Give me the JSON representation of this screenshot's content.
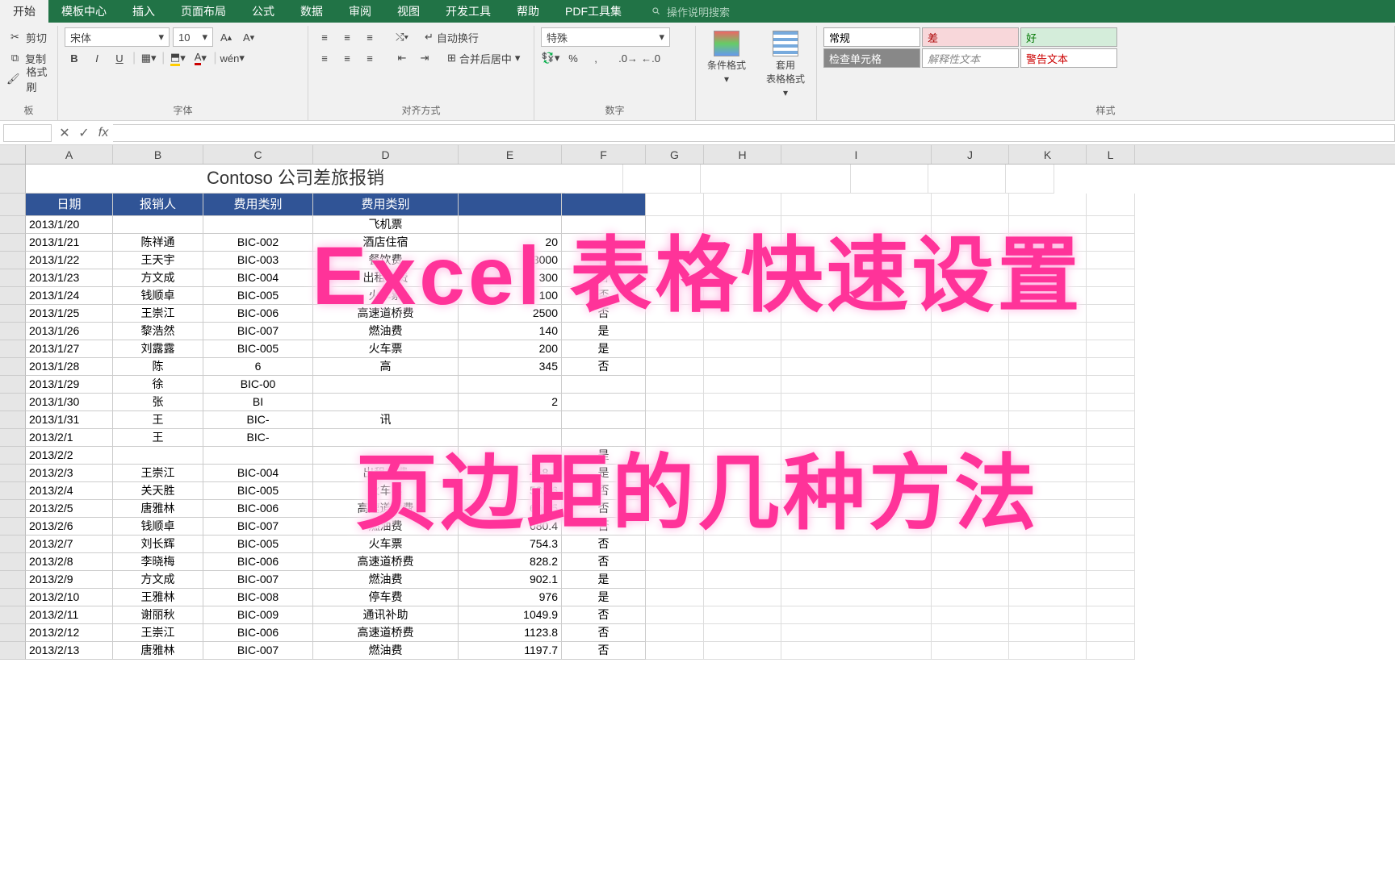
{
  "tabs": {
    "items": [
      "开始",
      "模板中心",
      "插入",
      "页面布局",
      "公式",
      "数据",
      "审阅",
      "视图",
      "开发工具",
      "帮助",
      "PDF工具集"
    ],
    "active_index": 0,
    "search_hint": "操作说明搜索"
  },
  "ribbon": {
    "clipboard": {
      "cut": "剪切",
      "copy": "复制",
      "painter": "格式刷",
      "label": "板"
    },
    "font": {
      "name": "宋体",
      "size": "10",
      "bold": "B",
      "italic": "I",
      "underline": "U",
      "pinyin": "wén",
      "label": "字体"
    },
    "alignment": {
      "wrap": "自动换行",
      "merge": "合并后居中",
      "label": "对齐方式"
    },
    "number": {
      "format": "特殊",
      "pct": "%",
      "comma": ",",
      "inc": "增",
      "dec": "减",
      "label": "数字"
    },
    "cond_format": "条件格式",
    "table_format": "套用\n表格格式",
    "styles": {
      "r1": [
        "常规",
        "差",
        "好"
      ],
      "r2": [
        "检查单元格",
        "解释性文本",
        "警告文本"
      ],
      "label": "样式"
    }
  },
  "formula_bar": {
    "namebox": "",
    "fx": "fx"
  },
  "columns": [
    "A",
    "B",
    "C",
    "D",
    "E",
    "F",
    "G",
    "H",
    "I",
    "J",
    "K",
    "L"
  ],
  "sheet": {
    "title": "Contoso 公司差旅报销",
    "headers": [
      "日期",
      "报销人",
      "费用类别",
      "费用类别",
      "",
      "",
      ""
    ],
    "rows": [
      {
        "a": "2013/1/20",
        "b": "",
        "c": "",
        "d": "飞机票",
        "e": "",
        "f": ""
      },
      {
        "a": "2013/1/21",
        "b": "陈祥通",
        "c": "BIC-002",
        "d": "酒店住宿",
        "e": "20",
        "f": ""
      },
      {
        "a": "2013/1/22",
        "b": "王天宇",
        "c": "BIC-003",
        "d": "餐饮费",
        "e": "3000",
        "f": "否"
      },
      {
        "a": "2013/1/23",
        "b": "方文成",
        "c": "BIC-004",
        "d": "出租车费",
        "e": "300",
        "f": "否"
      },
      {
        "a": "2013/1/24",
        "b": "钱顺卓",
        "c": "BIC-005",
        "d": "火车票",
        "e": "100",
        "f": "否"
      },
      {
        "a": "2013/1/25",
        "b": "王崇江",
        "c": "BIC-006",
        "d": "高速道桥费",
        "e": "2500",
        "f": "否"
      },
      {
        "a": "2013/1/26",
        "b": "黎浩然",
        "c": "BIC-007",
        "d": "燃油费",
        "e": "140",
        "f": "是"
      },
      {
        "a": "2013/1/27",
        "b": "刘露露",
        "c": "BIC-005",
        "d": "火车票",
        "e": "200",
        "f": "是"
      },
      {
        "a": "2013/1/28",
        "b": "陈",
        "c": "6",
        "d": "高",
        "e": "345",
        "f": "否"
      },
      {
        "a": "2013/1/29",
        "b": "徐",
        "c": "BIC-00",
        "d": "",
        "e": "",
        "f": ""
      },
      {
        "a": "2013/1/30",
        "b": "张",
        "c": "BI",
        "d": "",
        "e": "2",
        "f": ""
      },
      {
        "a": "2013/1/31",
        "b": "王",
        "c": "BIC-",
        "d": "讯",
        "e": "",
        "f": ""
      },
      {
        "a": "2013/2/1",
        "b": "王",
        "c": "BIC-",
        "d": "",
        "e": "",
        "f": ""
      },
      {
        "a": "2013/2/2",
        "b": "",
        "c": "",
        "d": "",
        "e": "",
        "f": "是"
      },
      {
        "a": "2013/2/3",
        "b": "王崇江",
        "c": "BIC-004",
        "d": "出租车费",
        "e": "458.7",
        "f": "是"
      },
      {
        "a": "2013/2/4",
        "b": "关天胜",
        "c": "BIC-005",
        "d": "火车票",
        "e": "532.6",
        "f": "否"
      },
      {
        "a": "2013/2/5",
        "b": "唐雅林",
        "c": "BIC-006",
        "d": "高速道桥费",
        "e": "606.5",
        "f": "否"
      },
      {
        "a": "2013/2/6",
        "b": "钱顺卓",
        "c": "BIC-007",
        "d": "燃油费",
        "e": "680.4",
        "f": "否"
      },
      {
        "a": "2013/2/7",
        "b": "刘长辉",
        "c": "BIC-005",
        "d": "火车票",
        "e": "754.3",
        "f": "否"
      },
      {
        "a": "2013/2/8",
        "b": "李晓梅",
        "c": "BIC-006",
        "d": "高速道桥费",
        "e": "828.2",
        "f": "否"
      },
      {
        "a": "2013/2/9",
        "b": "方文成",
        "c": "BIC-007",
        "d": "燃油费",
        "e": "902.1",
        "f": "是"
      },
      {
        "a": "2013/2/10",
        "b": "王雅林",
        "c": "BIC-008",
        "d": "停车费",
        "e": "976",
        "f": "是"
      },
      {
        "a": "2013/2/11",
        "b": "谢丽秋",
        "c": "BIC-009",
        "d": "通讯补助",
        "e": "1049.9",
        "f": "否"
      },
      {
        "a": "2013/2/12",
        "b": "王崇江",
        "c": "BIC-006",
        "d": "高速道桥费",
        "e": "1123.8",
        "f": "否"
      },
      {
        "a": "2013/2/13",
        "b": "唐雅林",
        "c": "BIC-007",
        "d": "燃油费",
        "e": "1197.7",
        "f": "否"
      }
    ]
  },
  "overlay": {
    "line1": "Excel 表格快速设置",
    "line2": "页边距的几种方法"
  }
}
